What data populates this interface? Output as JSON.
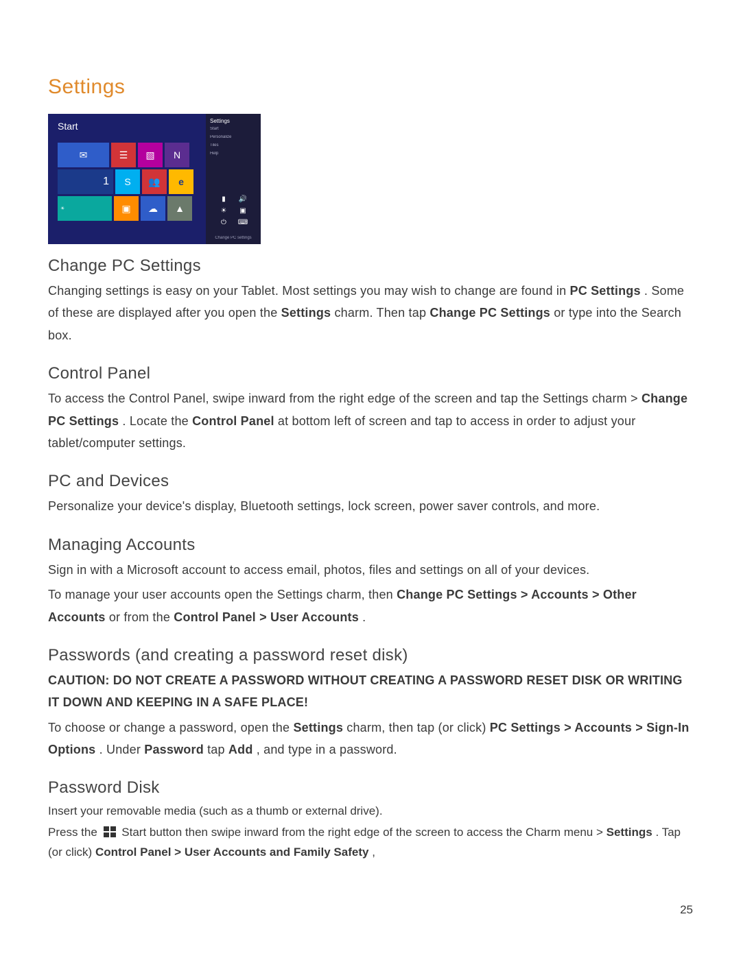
{
  "title": "Settings",
  "screenshot": {
    "start_label": "Start",
    "charm": {
      "title": "Settings",
      "lines": [
        "Start",
        "Personalize",
        "Tiles",
        "Help"
      ],
      "footer": "Change PC settings"
    }
  },
  "sections": {
    "change_pc": {
      "heading": "Change PC Settings",
      "p1a": "Changing settings is easy on your Tablet. Most settings you may wish to change are found in ",
      "p1b": "PC Settings",
      "p1c": ". Some of these are displayed after you open the ",
      "p1d": "Settings",
      "p1e": " charm. Then tap ",
      "p1f": "Change PC Settings",
      "p1g": " or type into the Search box."
    },
    "control_panel": {
      "heading": "Control Panel",
      "p1a": "To access the Control Panel, swipe inward from the right edge of the screen and tap the Settings charm > ",
      "p1b": "Change PC Settings",
      "p1c": ". Locate the ",
      "p1d": "Control Panel",
      "p1e": " at bottom left of screen and tap to access in order to adjust your tablet/computer settings."
    },
    "pc_devices": {
      "heading": "PC and Devices",
      "p1": "Personalize your device's display, Bluetooth settings, lock screen, power saver controls, and more."
    },
    "managing_accounts": {
      "heading": "Managing Accounts",
      "p1": "Sign in with a Microsoft account to access email, photos, files and settings on all of your devices.",
      "p2a": "To manage your user accounts open the Settings charm, then ",
      "p2b": "Change PC Settings > Accounts > Other Accounts",
      "p2c": " or from the ",
      "p2d": "Control Panel > User Accounts",
      "p2e": "."
    },
    "passwords": {
      "heading": "Passwords (and creating a password reset disk)",
      "caution": "CAUTION: DO NOT CREATE A PASSWORD WITHOUT CREATING A PASSWORD RESET DISK OR WRITING IT DOWN AND KEEPING IN A SAFE PLACE!",
      "p2a": "To choose or change a password, open the ",
      "p2b": "Settings",
      "p2c": " charm, then tap (or click) ",
      "p2d": "PC Settings > Accounts > Sign-In Options",
      "p2e": ". Under ",
      "p2f": "Password",
      "p2g": " tap ",
      "p2h": "Add",
      "p2i": ", and type in a password."
    },
    "password_disk": {
      "heading": "Password Disk",
      "p1": "Insert your removable media (such as a thumb or external drive).",
      "p2a": "Press the ",
      "p2b": " Start button then swipe inward from the right edge of the screen to access the Charm menu > ",
      "p2c": "Settings",
      "p2d": ". Tap (or click) ",
      "p2e": "Control Panel > User Accounts and Family Safety",
      "p2f": ","
    }
  },
  "page_number": "25"
}
